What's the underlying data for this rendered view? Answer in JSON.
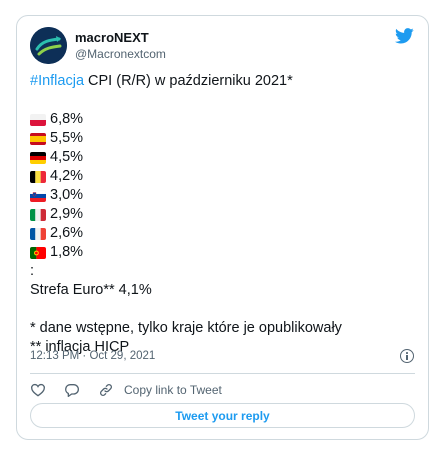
{
  "author": {
    "name": "macroNEXT",
    "handle": "@Macronextcom"
  },
  "tweet": {
    "hashtag": "#Inflacja",
    "headline": " CPI (R/R) w październiku 2021*",
    "entries": [
      {
        "flag": "Poland",
        "value": "6,8%"
      },
      {
        "flag": "Spain",
        "value": "5,5%"
      },
      {
        "flag": "Germany",
        "value": "4,5%"
      },
      {
        "flag": "Belgium",
        "value": "4,2%"
      },
      {
        "flag": "Slovenia",
        "value": "3,0%"
      },
      {
        "flag": "Italy",
        "value": "2,9%"
      },
      {
        "flag": "France",
        "value": "2,6%"
      },
      {
        "flag": "Portugal",
        "value": "1,8%"
      }
    ],
    "colon": ":",
    "euro_line": "Strefa Euro** 4,1%",
    "note1": "* dane wstępne, tylko kraje które je opublikowały",
    "note2": "** inflacja HICP"
  },
  "meta": {
    "timestamp": "12:13 PM · Oct 29, 2021"
  },
  "actions": {
    "copy_link": "Copy link to Tweet",
    "reply": "Tweet your reply"
  },
  "colors": {
    "accent": "#1d9bf0",
    "text": "#0f1419",
    "muted": "#536471",
    "border": "#cfd9de"
  },
  "icons": [
    "twitter-bird-icon",
    "heart-icon",
    "reply-bubble-icon",
    "link-icon",
    "info-icon"
  ]
}
